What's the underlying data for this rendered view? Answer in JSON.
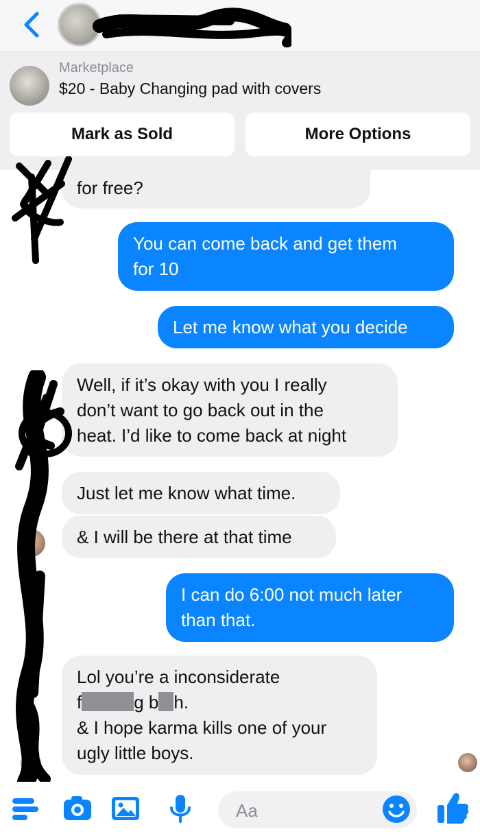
{
  "nav": {
    "back_icon": "chevron-left-icon",
    "contact_name_redacted": true
  },
  "listing": {
    "source": "Marketplace",
    "title": "$20 - Baby Changing pad with covers",
    "mark_sold_label": "Mark as Sold",
    "more_options_label": "More Options"
  },
  "messages": [
    {
      "from": "them",
      "lines": [
        "for free?"
      ]
    },
    {
      "from": "me",
      "lines": [
        "You can come back and get them",
        "for 10"
      ]
    },
    {
      "from": "me",
      "lines": [
        "Let me know what you decide"
      ]
    },
    {
      "from": "them",
      "lines": [
        "Well, if it’s okay with you I really",
        "don’t want to go back out in the",
        "heat. I’d like to come back at night"
      ]
    },
    {
      "from": "them",
      "lines": [
        "Just let me know what time."
      ]
    },
    {
      "from": "them",
      "lines": [
        "& I will be there at that time"
      ]
    },
    {
      "from": "me",
      "lines": [
        "I can do 6:00 not much later",
        "than that."
      ]
    },
    {
      "from": "them",
      "lines": [
        "Lol you’re a inconsiderate",
        "f",
        "g b",
        "h.",
        "& I hope karma kills one of your",
        "ugly little boys."
      ]
    }
  ],
  "composer": {
    "placeholder": "Aa",
    "icons": [
      "menu-icon",
      "camera-icon",
      "photo-icon",
      "microphone-icon",
      "emoji-icon",
      "thumbs-up-icon"
    ]
  },
  "colors": {
    "outgoing": "#0a84ff",
    "incoming": "#efeff1",
    "accent": "#0a84ff"
  }
}
